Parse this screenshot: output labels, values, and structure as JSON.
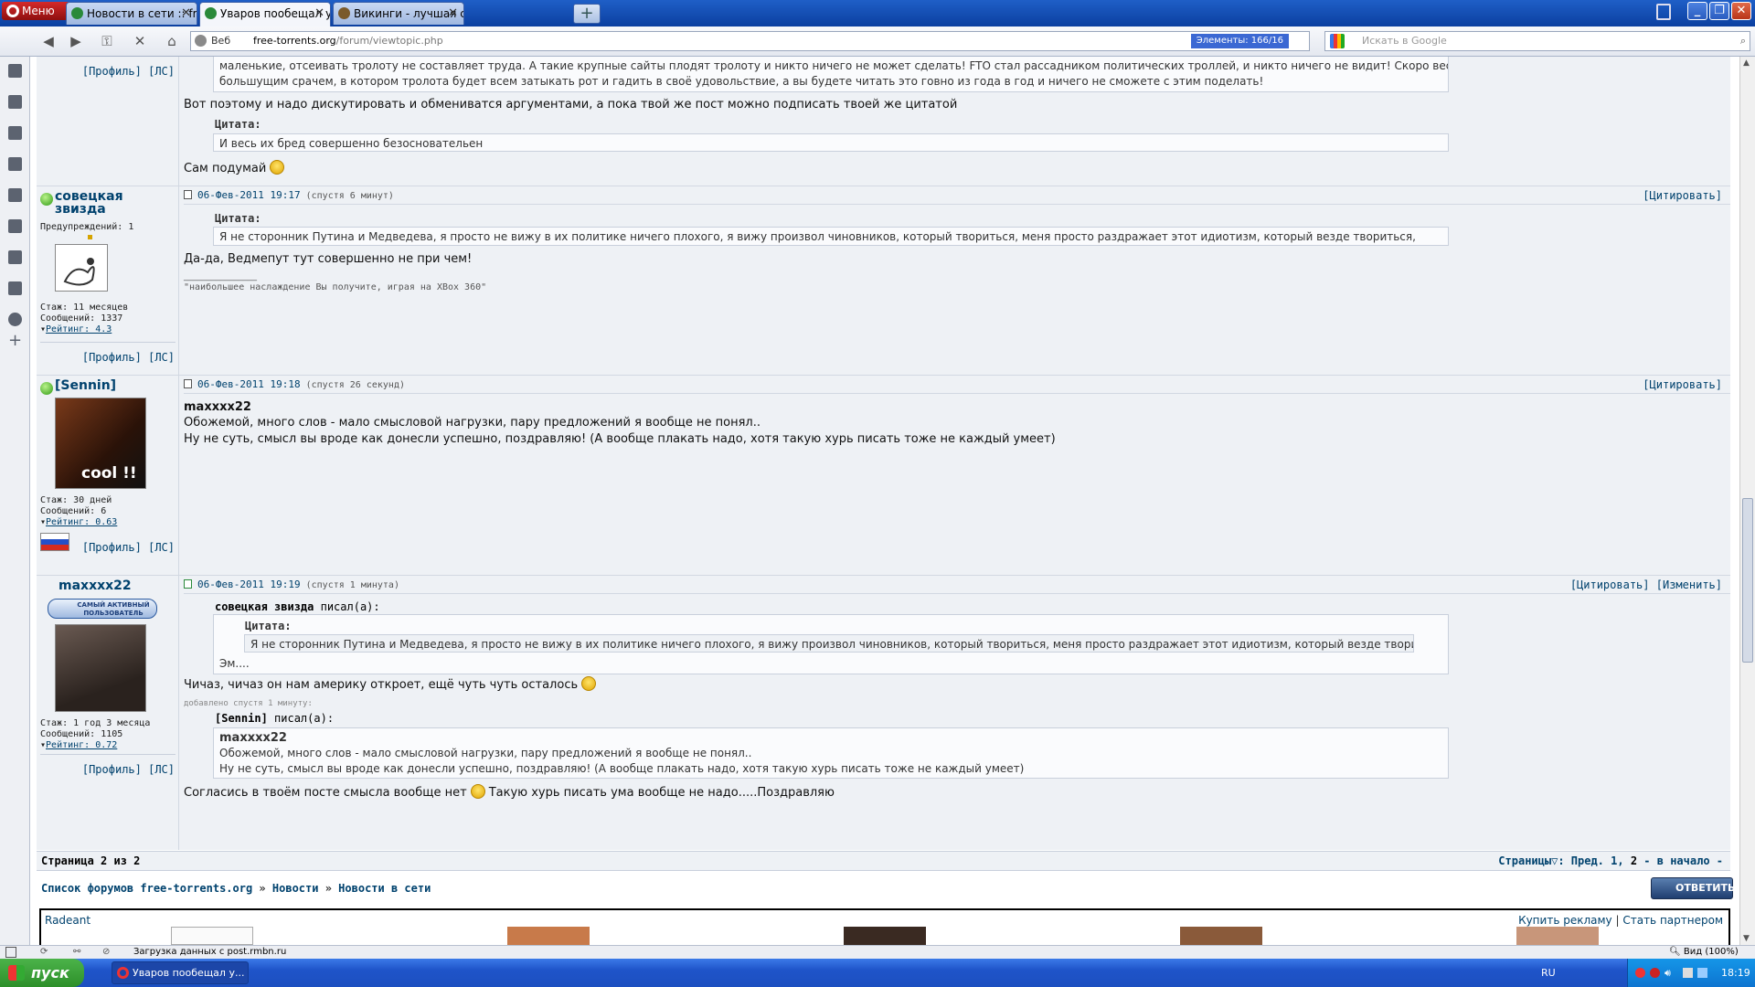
{
  "browser": {
    "menu_label": "Меню",
    "tabs": [
      {
        "title": "Новости в сети :: free-t..."
      },
      {
        "title": "Уваров пообещал устр..."
      },
      {
        "title": "Викинги - лучшая соци..."
      }
    ],
    "address_web": "Веб",
    "address_host": "free-torrents.org",
    "address_path": "/forum/viewtopic.php",
    "elements": "Элементы: 166/16",
    "search_placeholder": "Искать в Google"
  },
  "posts": {
    "p0": {
      "links": "[Профиль] [ЛС]",
      "quote_line1": "маленькие, отсеивать тролоту не составляет труда. А такие крупные сайты плодят тролоту и никто ничего не может сделать! FTO стал рассадником политических троллей, и никто ничего не видит! Скоро весь интернет станет одним",
      "quote_line2": "большущим срачем, в котором тролота будет всем затыкать рот и гадить в своё удовольствие, а вы будете читать это говно из года в год и ничего не сможете с этим поделать!",
      "text1": "Вот поэтому и надо дискутировать и обмениватся аргументами, а пока твой же пост можно подписать твоей же цитатой",
      "quote_label": "Цитата:",
      "quote2": "И весь их бред совершенно безосновательен",
      "text2": "Сам подумай"
    },
    "p1": {
      "author": "совецкая звизда",
      "warnings": "Предупреждений: 1",
      "stage": "Стаж: 11 месяцев",
      "messages": "Сообщений: 1337",
      "rating": "Рейтинг: 4.3",
      "links": "[Профиль] [ЛС]",
      "date": "06-Фев-2011 19:17",
      "ago": "(спустя 6 минут)",
      "quote_action": "[Цитировать]",
      "quote_label": "Цитата:",
      "quote": "Я не сторонник Путина и Медведева, я просто не вижу в их политике ничего плохого, я вижу произвол чиновников, который твориться, меня просто раздражает этот идиотизм, который везде твориться,",
      "text": "Да-да, Ведмепут тут совершенно не при чем!",
      "sig_line": "________________",
      "signature": "\"наибольшее наслаждение Вы получите, играя на XBox 360\""
    },
    "p2": {
      "author": "[Sennin]",
      "stage": "Стаж: 30 дней",
      "messages": "Сообщений: 6",
      "rating": "Рейтинг: 0.63",
      "links": "[Профиль] [ЛС]",
      "date": "06-Фев-2011 19:18",
      "ago": "(спустя 26 секунд)",
      "quote_action": "[Цитировать]",
      "bold_name": "maxxxx22",
      "line1": "Обожемой, много слов - мало смысловой нагрузки, пару предложений я вообще не понял..",
      "line2": "Ну не суть, смысл вы вроде как донесли успешно, поздравляю! (А вообще плакать надо, хотя такую хурь писать тоже не каждый умеет)",
      "avatar_text": "cool !!"
    },
    "p3": {
      "author": "maxxxx22",
      "badge": "САМЫЙ АКТИВНЫЙ ПОЛЬЗОВАТЕЛЬ",
      "stage": "Стаж: 1 год 3 месяца",
      "messages": "Сообщений: 1105",
      "rating": "Рейтинг: 0.72",
      "links": "[Профиль] [ЛС]",
      "date": "06-Фев-2011 19:19",
      "ago": "(спустя 1 минута)",
      "quote_action": "[Цитировать]",
      "edit_action": "[Изменить]",
      "wrote1_name": "совецкая звизда",
      "wrote_suffix": "писал(а):",
      "quote_label": "Цитата:",
      "inner_quote": "Я не сторонник Путина и Медведева, я просто не вижу в их политике ничего плохого, я вижу произвол чиновников, который твориться, меня просто раздражает этот идиотизм, который везде твориться,",
      "em": "Эм....",
      "text1": "Чичаз, чичаз он нам америку откроет, ещё чуть чуть осталось",
      "added": "добавлено спустя 1 минуту:",
      "wrote2_name": "[Sennin]",
      "q2_name": "maxxxx22",
      "q2_line1": "Обожемой, много слов - мало смысловой нагрузки, пару предложений я вообще не понял..",
      "q2_line2": "Ну не суть, смысл вы вроде как донесли успешно, поздравляю! (А вообще плакать надо, хотя такую хурь писать тоже не каждый умеет)",
      "text2a": "Согласись в твоём посте смысла вообще нет",
      "text2b": "Такую хурь писать ума вообще не надо.....Поздравляю"
    }
  },
  "pagination": {
    "left": "Страница 2 из 2",
    "pages_label": "Страницы",
    "prev": "Пред.",
    "p1": "1,",
    "p2": "2",
    "to_start": "- в начало -"
  },
  "breadcrumb": {
    "a": "Список форумов free-torrents.org",
    "b": "Новости",
    "c": "Новости в сети",
    "sep": "»"
  },
  "reply_label": "ОТВЕТИТЬ",
  "ads": {
    "left": "Radeant",
    "buy": "Купить рекламу",
    "partner": "Стать партнером",
    "sep": "|"
  },
  "status": {
    "text": "Загрузка данных с post.rmbn.ru",
    "zoom": "Вид (100%)"
  },
  "taskbar": {
    "start": "пуск",
    "app": "Уваров пообещал у...",
    "lang": "RU",
    "time": "18:19"
  }
}
